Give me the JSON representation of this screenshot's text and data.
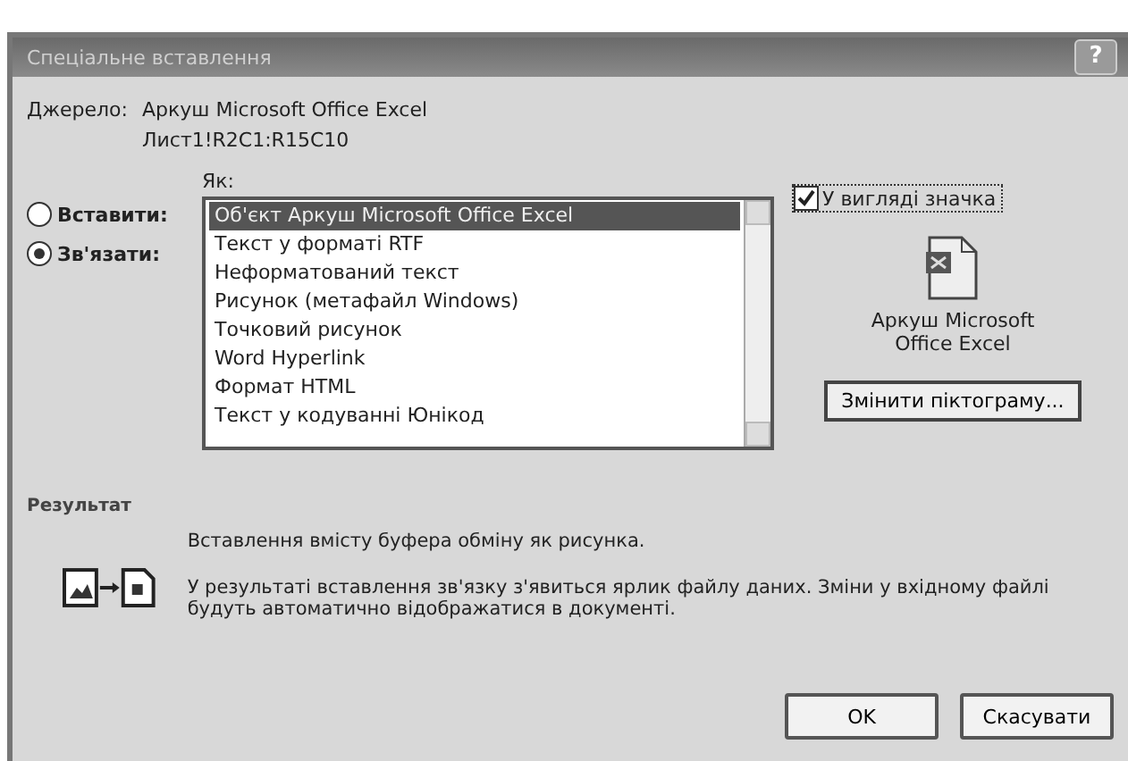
{
  "window": {
    "title": "Спеціальне вставлення",
    "help_button": "?"
  },
  "source": {
    "label": "Джерело:",
    "lines": [
      "Аркуш Microsoft Office Excel",
      "Лист1!R2C1:R15C10"
    ]
  },
  "as_label": "Як:",
  "options": [
    {
      "label": "Вставити:",
      "selected": false
    },
    {
      "label": "Зв'язати:",
      "selected": true
    }
  ],
  "formats": [
    {
      "label": "Об'єкт Аркуш Microsoft Office Excel",
      "selected": true
    },
    {
      "label": "Текст у форматі RTF",
      "selected": false
    },
    {
      "label": "Неформатований текст",
      "selected": false
    },
    {
      "label": "Рисунок (метафайл Windows)",
      "selected": false
    },
    {
      "label": "Точковий рисунок",
      "selected": false
    },
    {
      "label": "Word Hyperlink",
      "selected": false
    },
    {
      "label": "Формат HTML",
      "selected": false
    },
    {
      "label": "Текст у кодуванні Юнікод",
      "selected": false
    }
  ],
  "display_as_icon": {
    "label": "У вигляді значка",
    "checked": true
  },
  "icon_caption": "Аркуш Microsoft Office Excel",
  "change_icon_button": "Змінити піктограму...",
  "result": {
    "label": "Результат",
    "lines": [
      "Вставлення вмісту буфера обміну як рисунка.",
      "У результаті вставлення зв'язку з'явиться ярлик файлу даних. Зміни у вхідному файлі будуть автоматично відображатися в документі."
    ]
  },
  "buttons": [
    "OK",
    "Скасувати"
  ]
}
